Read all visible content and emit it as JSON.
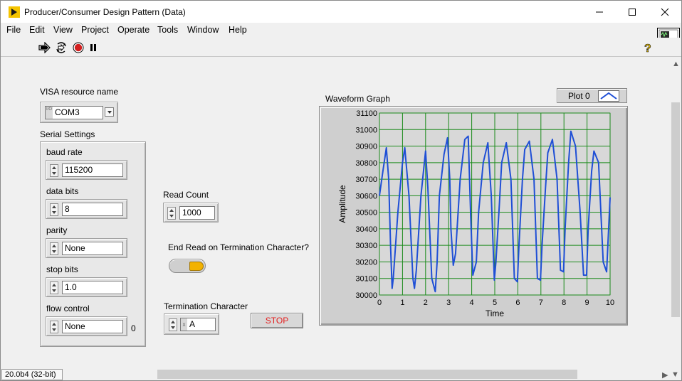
{
  "window": {
    "title": "Producer/Consumer Design Pattern (Data)"
  },
  "menu": [
    "File",
    "Edit",
    "View",
    "Project",
    "Operate",
    "Tools",
    "Window",
    "Help"
  ],
  "controls": {
    "visa": {
      "label": "VISA resource name",
      "value": "COM3",
      "tag": "%"
    },
    "serial_settings_label": "Serial Settings",
    "baud_rate": {
      "label": "baud rate",
      "value": "115200"
    },
    "data_bits": {
      "label": "data bits",
      "value": "8"
    },
    "parity": {
      "label": "parity",
      "value": "None"
    },
    "stop_bits": {
      "label": "stop bits",
      "value": "1.0"
    },
    "flow_control": {
      "label": "flow control",
      "value": "None",
      "index": "0"
    },
    "read_count": {
      "label": "Read Count",
      "value": "1000"
    },
    "end_read": {
      "label": "End Read on Termination Character?",
      "state": "on"
    },
    "termination": {
      "label": "Termination Character",
      "prefix": "x",
      "value": "A"
    },
    "stop": {
      "label": "STOP"
    }
  },
  "graph": {
    "title": "Waveform Graph",
    "legend": "Plot 0"
  },
  "status": {
    "version": "20.0b4 (32-bit)"
  },
  "colors": {
    "plot_line": "#1f4fd6",
    "plot_bg": "#d8d8d8",
    "grid": "#1a8a1a",
    "stop_text": "#e41e1e",
    "led_on": "#f2b200"
  },
  "chart_data": {
    "type": "line",
    "title": "Waveform Graph",
    "xlabel": "Time",
    "ylabel": "Amplitude",
    "xlim": [
      0,
      10
    ],
    "ylim": [
      30000,
      31100
    ],
    "xticks": [
      "0",
      "1",
      "2",
      "3",
      "4",
      "5",
      "6",
      "7",
      "8",
      "9",
      "10"
    ],
    "yticks": [
      "30000",
      "30100",
      "30200",
      "30300",
      "30400",
      "30500",
      "30600",
      "30700",
      "30800",
      "30900",
      "31000",
      "31100"
    ],
    "grid": true,
    "legend": "top-right",
    "series": [
      {
        "name": "Plot 0",
        "x": [
          0,
          0.15,
          0.3,
          0.4,
          0.48,
          0.55,
          0.6,
          0.8,
          1.0,
          1.1,
          1.28,
          1.45,
          1.52,
          1.6,
          1.8,
          2.0,
          2.1,
          2.27,
          2.42,
          2.5,
          2.6,
          2.8,
          2.95,
          3.05,
          3.1,
          3.2,
          3.3,
          3.5,
          3.7,
          3.85,
          3.95,
          4.05,
          4.2,
          4.3,
          4.5,
          4.7,
          4.85,
          4.98,
          5.05,
          5.2,
          5.3,
          5.5,
          5.7,
          5.85,
          5.98,
          6.05,
          6.2,
          6.3,
          6.5,
          6.7,
          6.85,
          6.98,
          7.05,
          7.2,
          7.3,
          7.5,
          7.7,
          7.85,
          7.98,
          8.05,
          8.2,
          8.3,
          8.5,
          8.7,
          8.85,
          8.98,
          9.05,
          9.2,
          9.3,
          9.5,
          9.7,
          9.85,
          10.0
        ],
        "y": [
          30600,
          30750,
          30890,
          30700,
          30300,
          30040,
          30100,
          30500,
          30800,
          30890,
          30600,
          30100,
          30040,
          30150,
          30600,
          30870,
          30650,
          30100,
          30020,
          30200,
          30600,
          30850,
          30950,
          30700,
          30400,
          30180,
          30250,
          30700,
          30940,
          30960,
          30500,
          30120,
          30200,
          30500,
          30800,
          30920,
          30600,
          30090,
          30200,
          30550,
          30800,
          30920,
          30700,
          30100,
          30080,
          30300,
          30700,
          30880,
          30930,
          30700,
          30100,
          30090,
          30300,
          30650,
          30860,
          30940,
          30700,
          30150,
          30140,
          30400,
          30800,
          30990,
          30900,
          30500,
          30120,
          30120,
          30400,
          30750,
          30870,
          30800,
          30200,
          30140,
          30590
        ]
      }
    ]
  }
}
